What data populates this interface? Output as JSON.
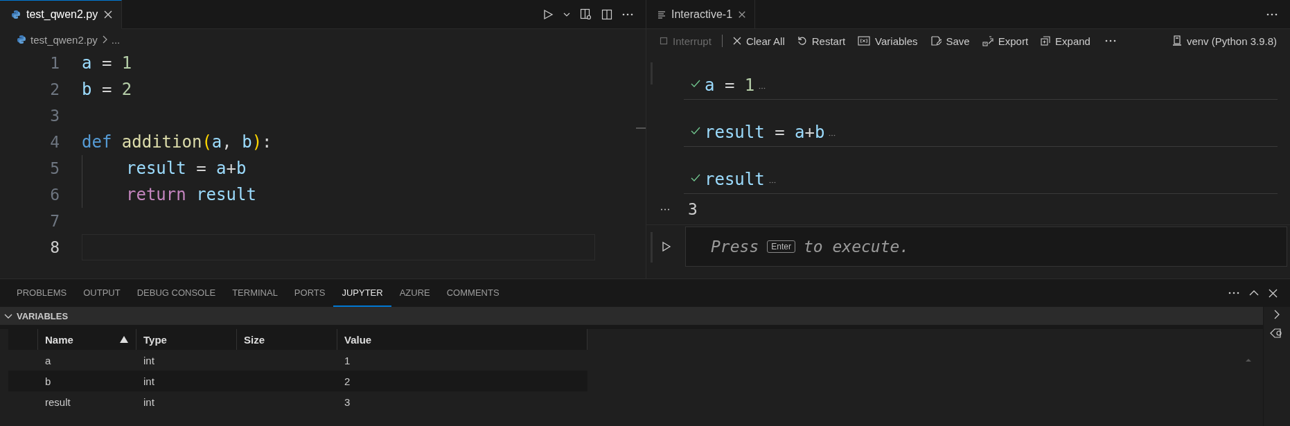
{
  "editor": {
    "tab": {
      "label": "test_qwen2.py",
      "selected": true
    },
    "breadcrumb": [
      "test_qwen2.py",
      "..."
    ],
    "lines": [
      {
        "number": "1",
        "current": false,
        "tokens": [
          {
            "text": "a",
            "kind": "variable"
          },
          {
            "text": " = ",
            "kind": "operator"
          },
          {
            "text": "1",
            "kind": "number"
          }
        ]
      },
      {
        "number": "2",
        "current": false,
        "tokens": [
          {
            "text": "b",
            "kind": "variable"
          },
          {
            "text": " = ",
            "kind": "operator"
          },
          {
            "text": "2",
            "kind": "number"
          }
        ]
      },
      {
        "number": "3",
        "current": false
      },
      {
        "number": "4",
        "current": false,
        "tokens": [
          {
            "text": "def ",
            "kind": "keyword"
          },
          {
            "text": "addition",
            "kind": "function"
          },
          {
            "text": "(",
            "kind": "paren"
          },
          {
            "text": "a",
            "kind": "variable"
          },
          {
            "text": ", ",
            "kind": "operator"
          },
          {
            "text": "b",
            "kind": "variable"
          },
          {
            "text": ")",
            "kind": "paren"
          },
          {
            "text": ":",
            "kind": "operator"
          }
        ]
      },
      {
        "number": "5",
        "current": false,
        "indented": true,
        "tokens": [
          {
            "text": "result",
            "kind": "variable"
          },
          {
            "text": " = ",
            "kind": "operator"
          },
          {
            "text": "a",
            "kind": "variable"
          },
          {
            "text": "+",
            "kind": "operator"
          },
          {
            "text": "b",
            "kind": "variable"
          }
        ]
      },
      {
        "number": "6",
        "current": false,
        "indented": true,
        "tokens": [
          {
            "text": "return ",
            "kind": "control"
          },
          {
            "text": "result",
            "kind": "variable"
          }
        ]
      },
      {
        "number": "7",
        "current": false
      },
      {
        "number": "8",
        "current": true
      }
    ]
  },
  "interactive": {
    "tab": {
      "label": "Interactive-1",
      "selected": true
    },
    "toolbar": [
      {
        "label": "Interrupt",
        "kind": "interrupt",
        "disabled": true
      },
      {
        "label": "Clear All",
        "kind": "clear",
        "disabled": false
      },
      {
        "label": "Restart",
        "kind": "restart",
        "disabled": false
      },
      {
        "label": "Variables",
        "kind": "variables",
        "disabled": false
      },
      {
        "label": "Save",
        "kind": "save",
        "disabled": false
      },
      {
        "label": "Export",
        "kind": "export",
        "disabled": false
      },
      {
        "label": "Expand",
        "kind": "expand",
        "disabled": false
      }
    ],
    "kernel": "venv (Python 3.9.8)",
    "cells": [
      {
        "succeeded": true,
        "tokens": [
          {
            "text": "a",
            "kind": "variable"
          },
          {
            "text": " = ",
            "kind": "operator"
          },
          {
            "text": "1",
            "kind": "number"
          }
        ]
      },
      {
        "succeeded": true,
        "tokens": [
          {
            "text": "result",
            "kind": "variable"
          },
          {
            "text": " = ",
            "kind": "operator"
          },
          {
            "text": "a",
            "kind": "variable"
          },
          {
            "text": "+",
            "kind": "operator"
          },
          {
            "text": "b",
            "kind": "variable"
          }
        ]
      },
      {
        "succeeded": true,
        "tokens": [
          {
            "text": "result",
            "kind": "variable"
          }
        ],
        "output": "3"
      }
    ],
    "input": {
      "hint_before": "Press",
      "key": "Enter",
      "hint_after": "to execute."
    }
  },
  "panel": {
    "tabs": [
      {
        "label": "PROBLEMS",
        "selected": false
      },
      {
        "label": "OUTPUT",
        "selected": false
      },
      {
        "label": "DEBUG CONSOLE",
        "selected": false
      },
      {
        "label": "TERMINAL",
        "selected": false
      },
      {
        "label": "PORTS",
        "selected": false
      },
      {
        "label": "JUPYTER",
        "selected": true
      },
      {
        "label": "AZURE",
        "selected": false
      },
      {
        "label": "COMMENTS",
        "selected": false
      }
    ],
    "section": {
      "title": "VARIABLES",
      "expanded": true
    },
    "table": {
      "columns": [
        {
          "label": "Name",
          "sorted": true
        },
        {
          "label": "Type",
          "sorted": false
        },
        {
          "label": "Size",
          "sorted": false
        },
        {
          "label": "Value",
          "sorted": false
        }
      ],
      "rows": [
        {
          "cells": [
            "a",
            "int",
            "",
            "1"
          ]
        },
        {
          "cells": [
            "b",
            "int",
            "",
            "2"
          ]
        },
        {
          "cells": [
            "result",
            "int",
            "",
            "3"
          ]
        }
      ]
    }
  }
}
